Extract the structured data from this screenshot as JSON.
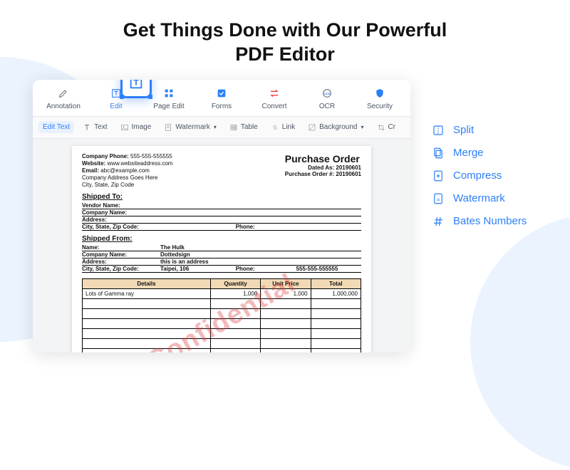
{
  "headline_line1": "Get Things Done with Our Powerful",
  "headline_line2": "PDF Editor",
  "mainTabs": [
    {
      "label": "Annotation"
    },
    {
      "label": "Edit"
    },
    {
      "label": "Page Edit"
    },
    {
      "label": "Forms"
    },
    {
      "label": "Convert"
    },
    {
      "label": "OCR"
    },
    {
      "label": "Security"
    }
  ],
  "subTools": {
    "editText": "Edit Text",
    "text": "Text",
    "image": "Image",
    "watermark": "Watermark",
    "table": "Table",
    "link": "Link",
    "background": "Background",
    "crop": "Cr"
  },
  "po": {
    "company_phone_label": "Company Phone:",
    "company_phone": "555-555-555555",
    "website_label": "Website:",
    "website": "www.websiteaddress.com",
    "email_label": "Email:",
    "email": "abc@example.com",
    "addr1": "Company Address Goes Here",
    "addr2": "City, State, Zip Code",
    "title": "Purchase Order",
    "dated_label": "Dated As:",
    "dated": "20190601",
    "ponum_label": "Purchase Order #:",
    "ponum": "20190601",
    "shippedTo": "Shipped To:",
    "shippedFrom": "Shipped From:",
    "vendorName": "Vendor Name:",
    "companyName": "Company Name:",
    "address": "Address:",
    "cityStateZip": "City, State, Zip Code:",
    "phone": "Phone:",
    "name": "Name:",
    "nameVal": "The Hulk",
    "companyVal": "Dottedsign",
    "addressVal": "this is an address",
    "cityVal": "Taipei, 106",
    "col_details": "Details",
    "col_qty": "Quantity",
    "col_unit": "Unit Price",
    "col_total": "Total",
    "row_item": "Lots of Gamma ray",
    "row_qty": "1,000",
    "row_unit": "1,000",
    "row_total": "1,000,000"
  },
  "watermark_text": "Confidential",
  "features": {
    "split": "Split",
    "merge": "Merge",
    "compress": "Compress",
    "watermark": "Watermark",
    "bates": "Bates Numbers"
  }
}
